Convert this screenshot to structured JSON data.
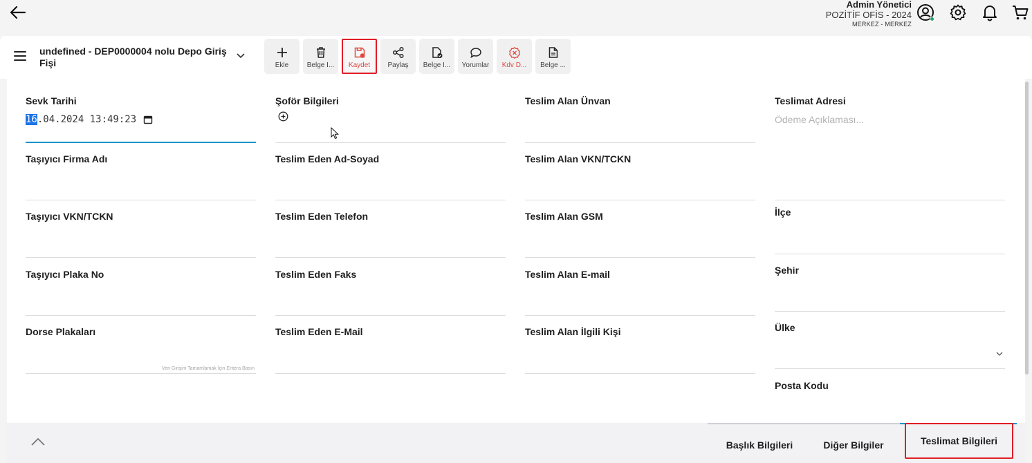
{
  "header": {
    "user_name": "Admin Yönetici",
    "company": "POZİTİF OFİS - 2024",
    "branch": "MERKEZ - MERKEZ"
  },
  "document": {
    "title": "undefined - DEP0000004 nolu Depo Giriş Fişi"
  },
  "toolbar": {
    "buttons": [
      {
        "label": "Ekle",
        "icon": "plus-icon"
      },
      {
        "label": "Belge İ...",
        "icon": "trash-icon"
      },
      {
        "label": "Kaydet",
        "icon": "save-icon"
      },
      {
        "label": "Paylaş",
        "icon": "share-icon"
      },
      {
        "label": "Belge İ...",
        "icon": "document-check-icon"
      },
      {
        "label": "Yorumlar",
        "icon": "comment-icon"
      },
      {
        "label": "Kdv D...",
        "icon": "vat-icon"
      },
      {
        "label": "Belge ...",
        "icon": "document-icon"
      }
    ],
    "highlight_color": "#e11d26"
  },
  "form": {
    "sevk_tarihi": {
      "label": "Sevk Tarihi",
      "value_selected": "16",
      "value_rest": ".04.2024 13:49:23"
    },
    "sofor_bilgileri": {
      "label": "Şoför Bilgileri"
    },
    "teslim_alan_unvan": {
      "label": "Teslim Alan Ünvan"
    },
    "teslimat_adresi": {
      "label": "Teslimat Adresi",
      "placeholder": "Ödeme Açıklaması..."
    },
    "tasiyici_firma_adi": {
      "label": "Taşıyıcı Firma Adı"
    },
    "teslim_eden_ad_soyad": {
      "label": "Teslim Eden Ad-Soyad"
    },
    "teslim_alan_vkn": {
      "label": "Teslim Alan VKN/TCKN"
    },
    "tasiyici_vkn": {
      "label": "Taşıyıcı VKN/TCKN"
    },
    "teslim_eden_telefon": {
      "label": "Teslim Eden Telefon"
    },
    "teslim_alan_gsm": {
      "label": "Teslim Alan GSM"
    },
    "ilce": {
      "label": "İlçe"
    },
    "tasiyici_plaka": {
      "label": "Taşıyıcı Plaka No"
    },
    "teslim_eden_faks": {
      "label": "Teslim Eden Faks"
    },
    "teslim_alan_email": {
      "label": "Teslim Alan E-mail"
    },
    "sehir": {
      "label": "Şehir"
    },
    "dorse_plakalari": {
      "label": "Dorse Plakaları",
      "hint": "Veri Girişini Tamamlamak İçin Entera Basın"
    },
    "teslim_eden_email": {
      "label": "Teslim Eden E-Mail"
    },
    "teslim_alan_ilgili_kisi": {
      "label": "Teslim Alan İlgili Kişi"
    },
    "ulke": {
      "label": "Ülke"
    },
    "posta_kodu": {
      "label": "Posta Kodu"
    }
  },
  "tabs": [
    {
      "label": "Başlık Bilgileri"
    },
    {
      "label": "Diğer Bilgiler"
    },
    {
      "label": "Teslimat Bilgileri",
      "active": true
    }
  ],
  "colors": {
    "accent": "#1e93c9",
    "highlight": "#e11d26",
    "online": "#21a366"
  }
}
